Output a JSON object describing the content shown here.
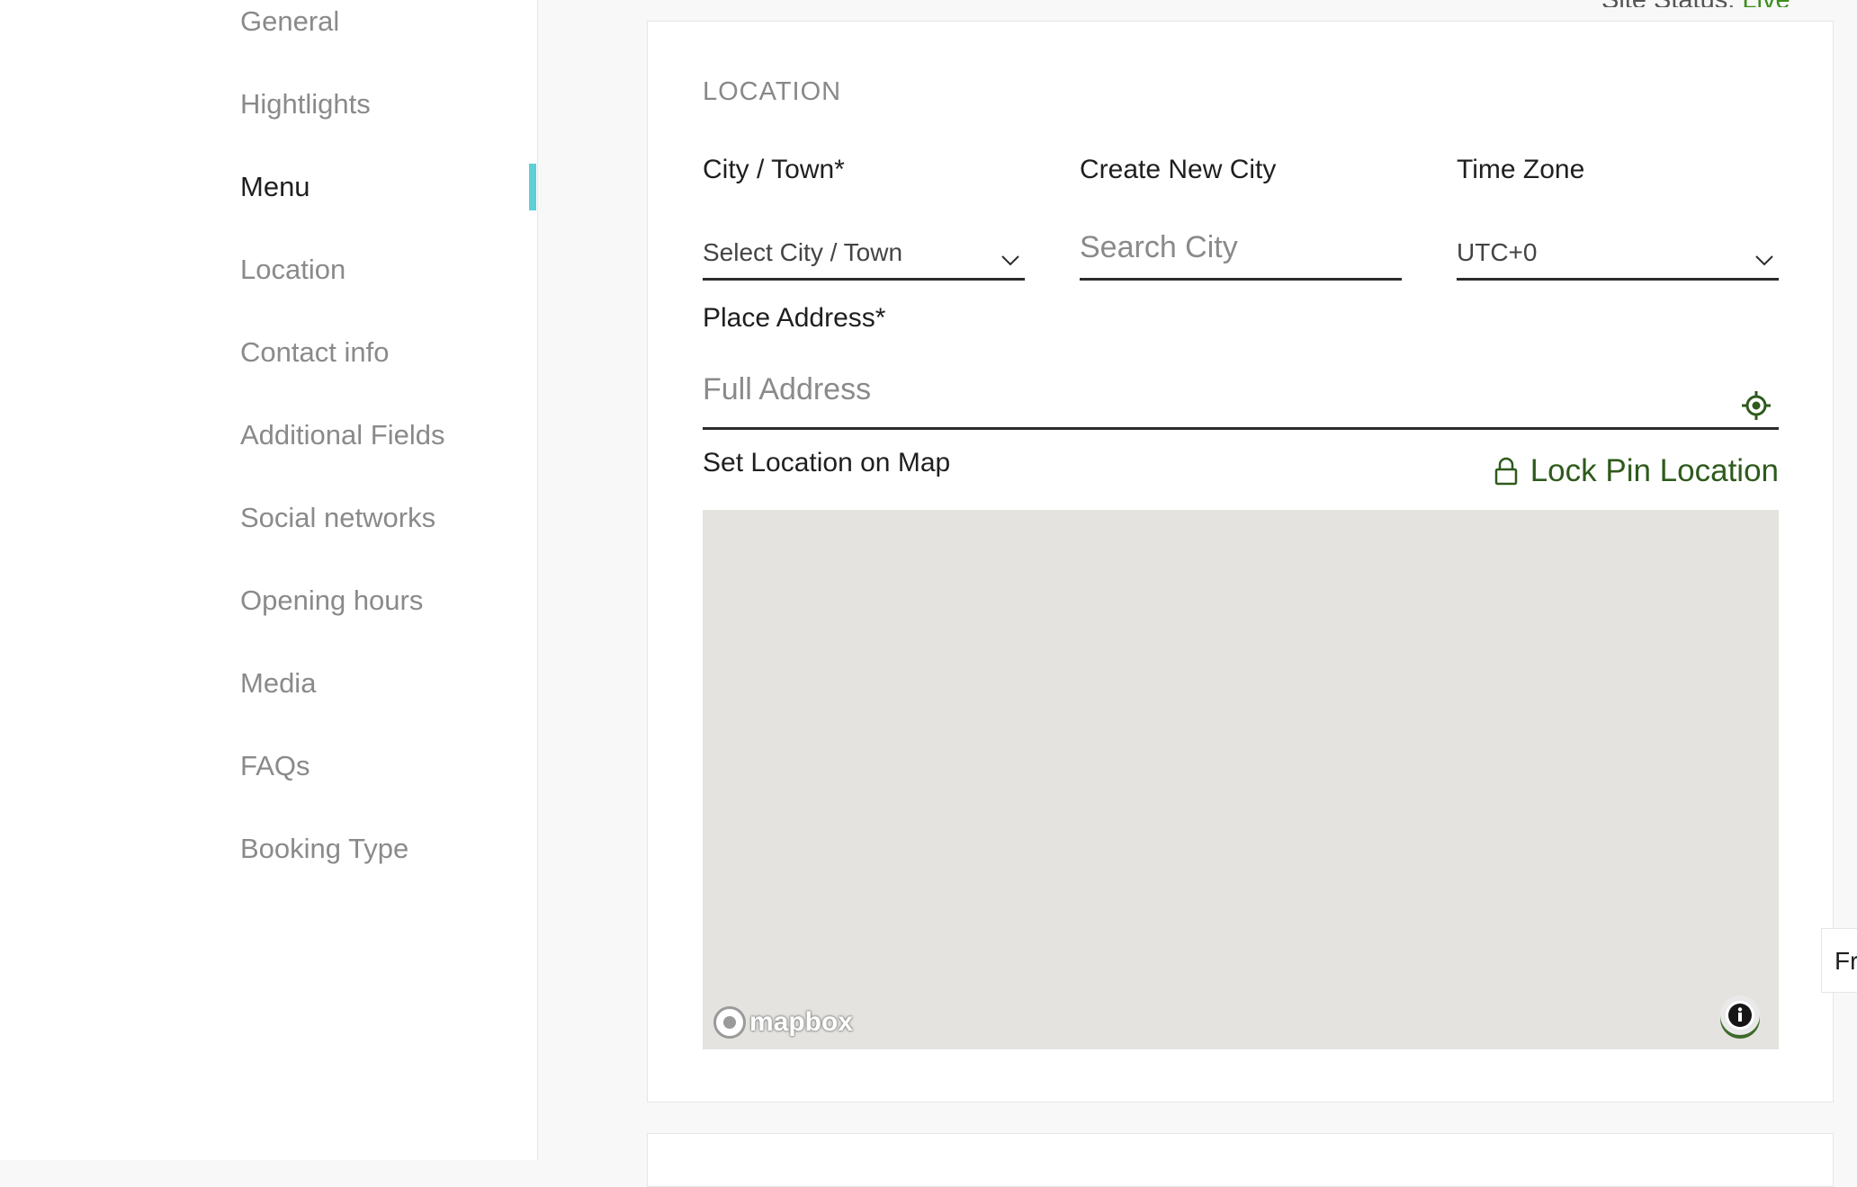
{
  "sidebar": {
    "items": [
      {
        "label": "General",
        "active": false
      },
      {
        "label": "Hightlights",
        "active": false
      },
      {
        "label": "Menu",
        "active": true
      },
      {
        "label": "Location",
        "active": false
      },
      {
        "label": "Contact info",
        "active": false
      },
      {
        "label": "Additional Fields",
        "active": false
      },
      {
        "label": "Social networks",
        "active": false
      },
      {
        "label": "Opening hours",
        "active": false
      },
      {
        "label": "Media",
        "active": false
      },
      {
        "label": "FAQs",
        "active": false
      },
      {
        "label": "Booking Type",
        "active": false
      }
    ]
  },
  "header": {
    "site_status_label": "Site Status:",
    "site_status_value": "Live"
  },
  "location": {
    "section_title": "LOCATION",
    "city": {
      "label": "City / Town*",
      "value": "Select City / Town"
    },
    "create_city": {
      "label": "Create New City",
      "placeholder": "Search City"
    },
    "timezone": {
      "label": "Time Zone",
      "value": "UTC+0"
    },
    "address": {
      "label": "Place Address*",
      "placeholder": "Full Address"
    },
    "map": {
      "label": "Set Location on Map",
      "lock_label": "Lock Pin Location",
      "attribution": "mapbox"
    }
  },
  "edge_tab": {
    "text": "Fr"
  },
  "colors": {
    "accent": "#5ecfd6",
    "lock_green": "#2e5a1c",
    "live_green": "#3b8e1e",
    "map_bg": "#e4e3df"
  }
}
